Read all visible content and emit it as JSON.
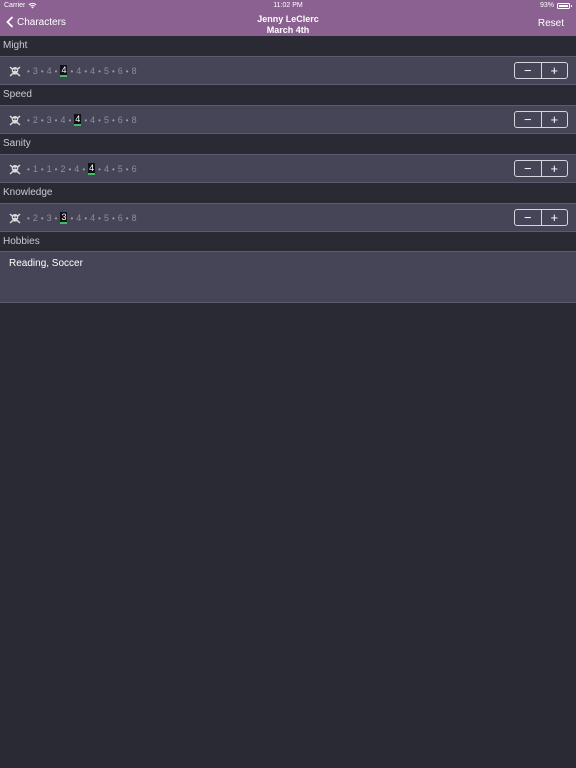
{
  "status": {
    "carrier": "Carrier",
    "time": "11:02 PM",
    "battery": "93%"
  },
  "nav": {
    "back_label": "Characters",
    "title": "Jenny LeClerc",
    "subtitle": "March 4th",
    "reset_label": "Reset"
  },
  "traits": [
    {
      "name": "Might",
      "values": [
        "3",
        "4",
        "4",
        "4",
        "4",
        "5",
        "6",
        "8"
      ],
      "current_index": 2
    },
    {
      "name": "Speed",
      "values": [
        "2",
        "3",
        "4",
        "4",
        "4",
        "5",
        "6",
        "8"
      ],
      "current_index": 3
    },
    {
      "name": "Sanity",
      "values": [
        "1",
        "1",
        "2",
        "4",
        "4",
        "4",
        "5",
        "6"
      ],
      "current_index": 4
    },
    {
      "name": "Knowledge",
      "values": [
        "2",
        "3",
        "3",
        "4",
        "4",
        "5",
        "6",
        "8"
      ],
      "current_index": 2
    }
  ],
  "stepper": {
    "minus": "−",
    "plus": "+"
  },
  "hobbies": {
    "label": "Hobbies",
    "value": "Reading, Soccer"
  },
  "colors": {
    "nav": "#8a6190",
    "background": "#2a2a35",
    "row": "#454557",
    "current_underline": "#3fbf5f"
  },
  "icons": {
    "death_marker": "skull-crossbones-icon"
  }
}
